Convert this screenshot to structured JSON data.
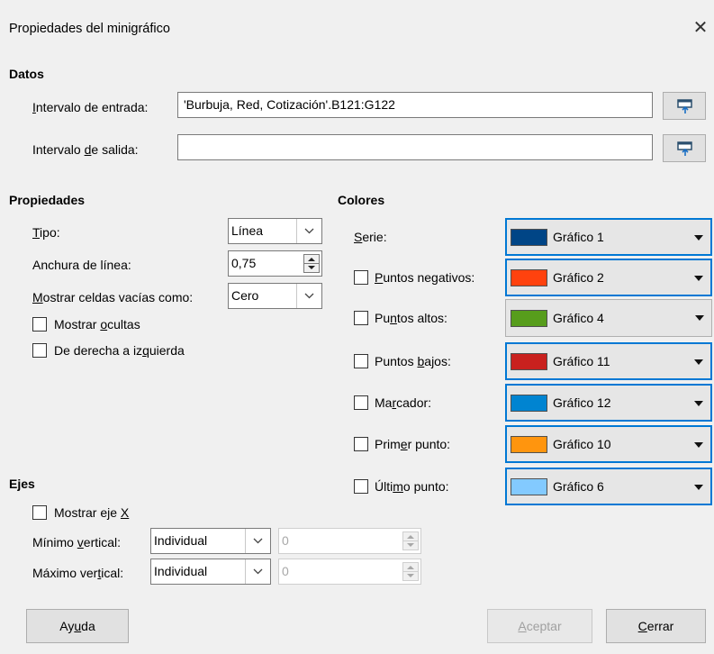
{
  "window": {
    "title": "Propiedades del minigráfico",
    "close_glyph": "✕"
  },
  "datos": {
    "heading": "Datos",
    "input_range": {
      "label_pre": "",
      "label_ul": "I",
      "label_post": "ntervalo de entrada:",
      "value": "'Burbuja, Red, Cotización'.B121:G122"
    },
    "output_range": {
      "label_pre": "Intervalo ",
      "label_ul": "d",
      "label_post": "e salida:",
      "value": ""
    }
  },
  "propiedades": {
    "heading": "Propiedades",
    "tipo": {
      "label_pre": "",
      "label_ul": "T",
      "label_post": "ipo:",
      "value": "Línea"
    },
    "anchura": {
      "label": "Anchura de línea:",
      "value": "0,75"
    },
    "celdas": {
      "label_pre": "",
      "label_ul": "M",
      "label_post": "ostrar celdas vacías como:",
      "value": "Cero"
    },
    "ocultas": {
      "label_pre": "Mostrar ",
      "label_ul": "o",
      "label_post": "cultas",
      "checked": false
    },
    "derecha": {
      "label_pre": "De derecha a iz",
      "label_ul": "q",
      "label_post": "uierda",
      "checked": false
    }
  },
  "colores": {
    "heading": "Colores",
    "items": [
      {
        "label_pre": "",
        "label_ul": "S",
        "label_post": "erie:",
        "has_checkbox": false,
        "color_name": "Gráfico 1",
        "color": "#004586",
        "focused": true
      },
      {
        "label_pre": "",
        "label_ul": "P",
        "label_post": "untos negativos:",
        "has_checkbox": true,
        "color_name": "Gráfico 2",
        "color": "#ff420e",
        "focused": true
      },
      {
        "label_pre": "Pu",
        "label_ul": "n",
        "label_post": "tos altos:",
        "has_checkbox": true,
        "color_name": "Gráfico 4",
        "color": "#579d1c",
        "focused": false
      },
      {
        "label_pre": "Puntos ",
        "label_ul": "b",
        "label_post": "ajos:",
        "has_checkbox": true,
        "color_name": "Gráfico 11",
        "color": "#c9211e",
        "focused": true
      },
      {
        "label_pre": "Ma",
        "label_ul": "r",
        "label_post": "cador:",
        "has_checkbox": true,
        "color_name": "Gráfico 12",
        "color": "#0084d1",
        "focused": true
      },
      {
        "label_pre": "Prim",
        "label_ul": "e",
        "label_post": "r punto:",
        "has_checkbox": true,
        "color_name": "Gráfico 10",
        "color": "#ff950e",
        "focused": true
      },
      {
        "label_pre": "Últi",
        "label_ul": "m",
        "label_post": "o punto:",
        "has_checkbox": true,
        "color_name": "Gráfico 6",
        "color": "#83caff",
        "focused": true
      }
    ]
  },
  "ejes": {
    "heading": "Ejes",
    "mostrar_x": {
      "label_pre": "Mostrar eje ",
      "label_ul": "X",
      "label_post": "",
      "checked": false
    },
    "min": {
      "label_pre": "Mínimo ",
      "label_ul": "v",
      "label_post": "ertical:",
      "mode": "Individual",
      "value": "0"
    },
    "max": {
      "label_pre": "Máximo ver",
      "label_ul": "t",
      "label_post": "ical:",
      "mode": "Individual",
      "value": "0"
    }
  },
  "buttons": {
    "help": {
      "pre": "Ay",
      "ul": "u",
      "post": "da"
    },
    "ok": {
      "pre": "",
      "ul": "A",
      "post": "ceptar"
    },
    "close": {
      "pre": "",
      "ul": "C",
      "post": "errar"
    }
  }
}
